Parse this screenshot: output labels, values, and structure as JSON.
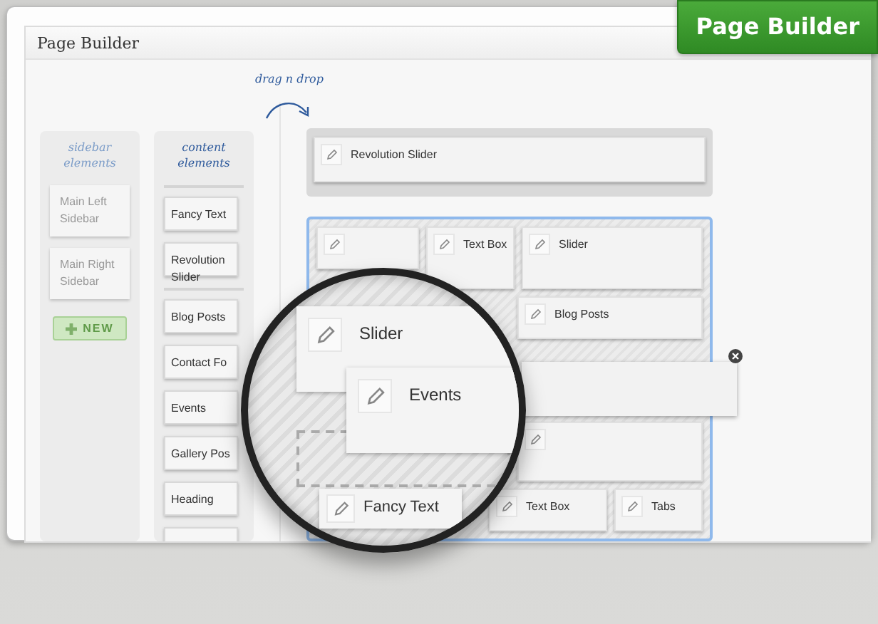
{
  "badge": "Page Builder",
  "panel": {
    "title": "Page Builder"
  },
  "hint": "drag n drop",
  "sidebar": {
    "heading": "sidebar elements",
    "items": [
      "Main Left Sidebar",
      "Main Right Sidebar"
    ],
    "new_button": "NEW"
  },
  "content": {
    "heading": "content elements",
    "groups": [
      [
        "Fancy Text",
        "Revolution Slider"
      ],
      [
        "Blog Posts",
        "Contact Fo",
        "Events",
        "Gallery Pos",
        "Heading"
      ]
    ]
  },
  "canvas": {
    "top_block": "Revolution Slider",
    "rows": [
      [
        {
          "kind": "card"
        },
        {
          "kind": "card",
          "label": "Text Box"
        },
        {
          "kind": "card",
          "label": "Slider"
        }
      ],
      [
        {
          "kind": "empty"
        },
        {
          "kind": "card",
          "label": "Blog Posts"
        }
      ],
      [
        {
          "kind": "empty"
        }
      ],
      [
        {
          "kind": "empty"
        },
        {
          "kind": "card"
        }
      ],
      [
        {
          "kind": "empty"
        },
        {
          "kind": "card",
          "label": "Text Box"
        },
        {
          "kind": "card",
          "label": "Tabs"
        }
      ]
    ]
  },
  "magnifier": {
    "cards": [
      {
        "kind": "slider",
        "label": "Slider"
      },
      {
        "kind": "dragged",
        "label": "Events"
      },
      {
        "kind": "placeholder"
      },
      {
        "kind": "fancy",
        "label": "Fancy Text"
      }
    ]
  }
}
